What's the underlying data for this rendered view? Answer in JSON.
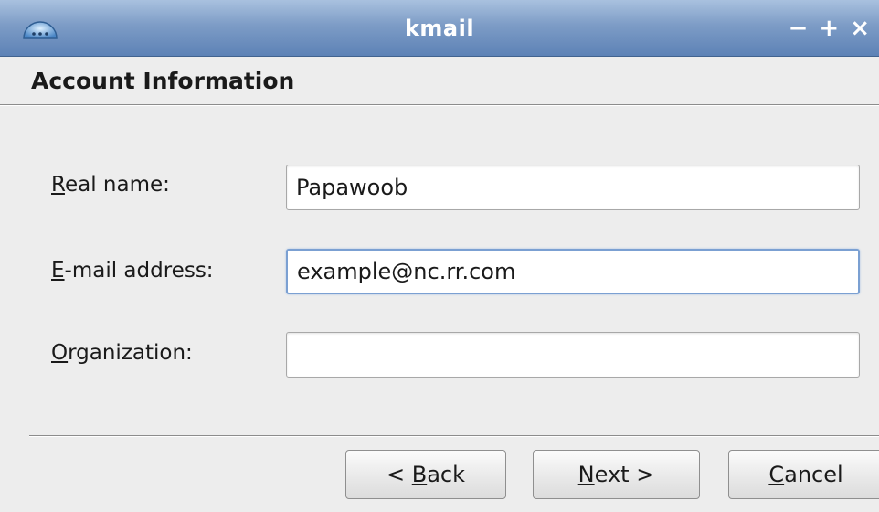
{
  "window": {
    "title": "kmail",
    "controls": {
      "minimize": "−",
      "maximize": "+",
      "close": "×"
    }
  },
  "header": {
    "title": "Account Information"
  },
  "form": {
    "real_name": {
      "mnemonic": "R",
      "label_rest": "eal name:",
      "value": "Papawoob"
    },
    "email": {
      "mnemonic": "E",
      "label_rest": "-mail address:",
      "value": "example@nc.rr.com"
    },
    "organization": {
      "mnemonic": "O",
      "label_rest": "rganization:",
      "value": ""
    }
  },
  "buttons": {
    "back": {
      "prefix": "< ",
      "mnemonic": "B",
      "rest": "ack"
    },
    "next": {
      "prefix": "",
      "mnemonic": "N",
      "rest": "ext >"
    },
    "cancel": {
      "prefix": "",
      "mnemonic": "C",
      "rest": "ancel"
    }
  },
  "colors": {
    "titlebar": "#7d9cc6",
    "focus_border": "#7ba0d2"
  },
  "icons": {
    "app": "kde-app-icon"
  }
}
